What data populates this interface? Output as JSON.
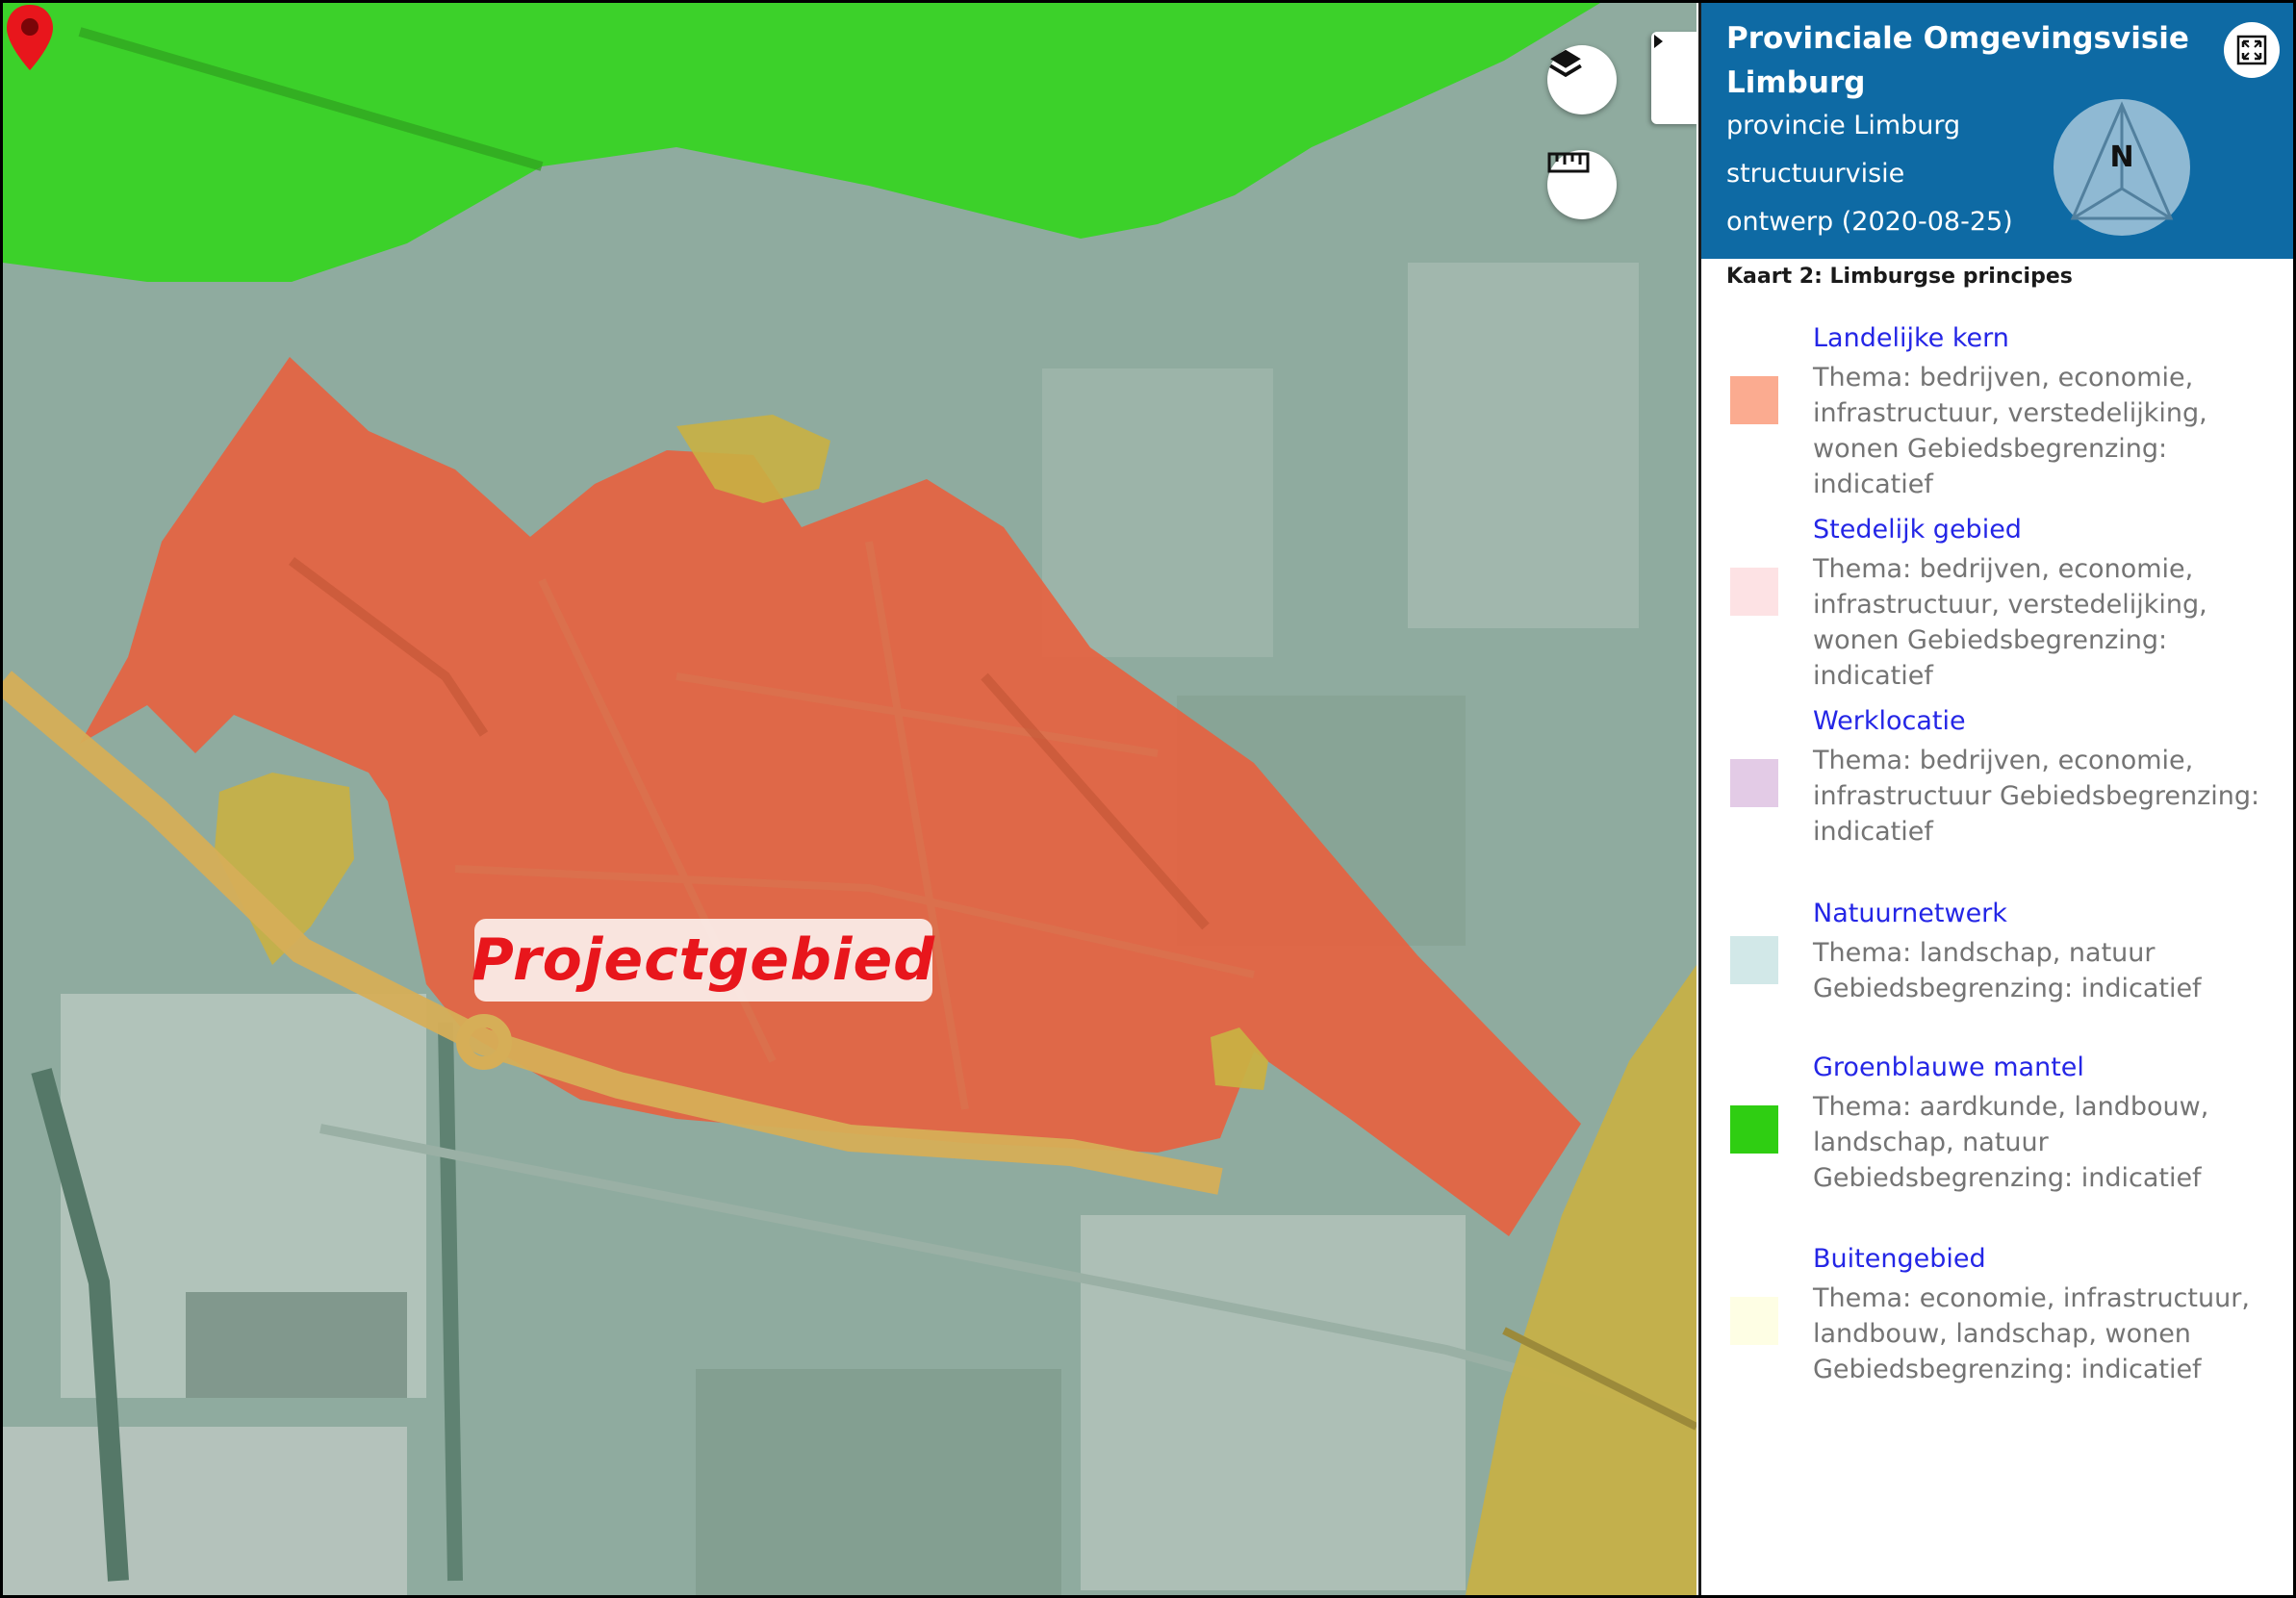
{
  "map": {
    "project_label": "Projectgebied",
    "controls": {
      "layers_icon": "layers-icon",
      "measure_icon": "ruler-icon",
      "collapse_icon": "caret-right-icon"
    },
    "colors": {
      "groenblauwe_mantel": "#3cd12a",
      "natuurnetwerk": "#a6d3d5",
      "landelijke_kern": "#e8603e",
      "buitengebied": "#c9b043",
      "marker": "#e8161c"
    }
  },
  "panel": {
    "title": "Provinciale Omgevingsvisie Limburg",
    "owner": "provincie Limburg",
    "type": "structuurvisie",
    "status": "ontwerp (2020-08-25)",
    "compass_label": "N",
    "fullscreen_icon": "fullscreen-icon",
    "map_subtitle": "Kaart 2: Limburgse principes",
    "header_color": "#0e6aa4",
    "legend": [
      {
        "title": "Landelijke kern",
        "desc": "Thema: bedrijven, economie, infrastructuur, verstedelijking, wonen Gebiedsbegrenzing: indicatief",
        "color": "#fbab90"
      },
      {
        "title": "Stedelijk gebied",
        "desc": "Thema: bedrijven, economie, infrastructuur, verstedelijking, wonen Gebiedsbegrenzing: indicatief",
        "color": "#fde2e4"
      },
      {
        "title": "Werklocatie",
        "desc": "Thema: bedrijven, economie, infrastructuur Gebiedsbegrenzing: indicatief",
        "color": "#e3cbe6"
      },
      {
        "title": "Natuurnetwerk",
        "desc": "Thema: landschap, natuur Gebiedsbegrenzing: indicatief",
        "color": "#d2e8e8"
      },
      {
        "title": "Groenblauwe mantel",
        "desc": "Thema: aardkunde, landbouw, landschap, natuur Gebiedsbegrenzing: indicatief",
        "color": "#2fce12"
      },
      {
        "title": "Buitengebied",
        "desc": "Thema: economie, infrastructuur, landbouw, landschap, wonen Gebiedsbegrenzing: indicatief",
        "color": "#fefee4"
      }
    ]
  }
}
